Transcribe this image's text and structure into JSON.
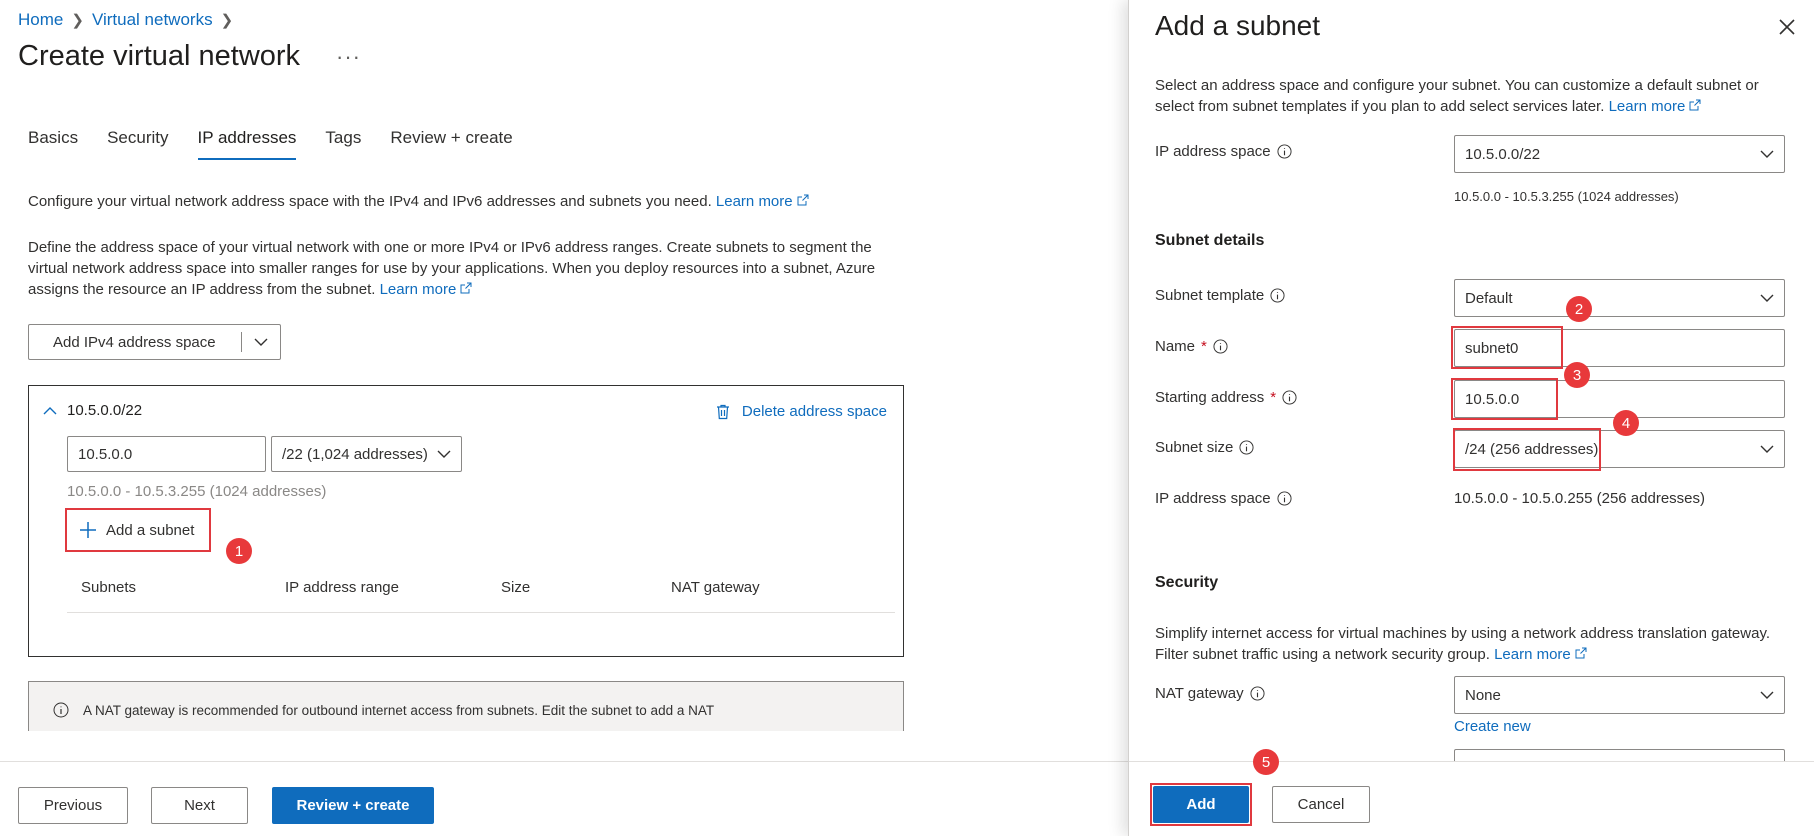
{
  "breadcrumb": {
    "home": "Home",
    "virtual_networks": "Virtual networks"
  },
  "page": {
    "title": "Create virtual network",
    "more": "···"
  },
  "tabs": [
    {
      "label": "Basics"
    },
    {
      "label": "Security"
    },
    {
      "label": "IP addresses",
      "active": true
    },
    {
      "label": "Tags"
    },
    {
      "label": "Review + create"
    }
  ],
  "intro": {
    "line1": "Configure your virtual network address space with the IPv4 and IPv6 addresses and subnets you need.",
    "learn_more": "Learn more",
    "line2": "Define the address space of your virtual network with one or more IPv4 or IPv6 address ranges. Create subnets to segment the virtual network address space into smaller ranges for use by your applications. When you deploy resources into a subnet, Azure assigns the resource an IP address from the subnet."
  },
  "add_space_button": "Add IPv4 address space",
  "address_space": {
    "title": "10.5.0.0/22",
    "delete_label": "Delete address space",
    "address_value": "10.5.0.0",
    "size_value": "/22 (1,024 addresses)",
    "range_text": "10.5.0.0 - 10.5.3.255 (1024 addresses)",
    "add_subnet_label": "Add a subnet",
    "table_headers": [
      "Subnets",
      "IP address range",
      "Size",
      "NAT gateway"
    ]
  },
  "nat_info": "A NAT gateway is recommended for outbound internet access from subnets. Edit the subnet to add a NAT",
  "footer": {
    "previous": "Previous",
    "next": "Next",
    "review": "Review + create"
  },
  "panel": {
    "title": "Add a subnet",
    "description": "Select an address space and configure your subnet. You can customize a default subnet or select from subnet templates if you plan to add select services later.",
    "learn_more": "Learn more",
    "ip_space_label": "IP address space",
    "ip_space_value": "10.5.0.0/22",
    "ip_space_range": "10.5.0.0 - 10.5.3.255 (1024 addresses)",
    "subnet_details_heading": "Subnet details",
    "template_label": "Subnet template",
    "template_value": "Default",
    "name_label": "Name",
    "name_value": "subnet0",
    "starting_label": "Starting address",
    "starting_value": "10.5.0.0",
    "size_label": "Subnet size",
    "size_value": "/24 (256 addresses)",
    "ip_space2_label": "IP address space",
    "ip_space2_value": "10.5.0.0 - 10.5.0.255 (256 addresses)",
    "security_heading": "Security",
    "security_desc": "Simplify internet access for virtual machines by using a network address translation gateway. Filter subnet traffic using a network security group.",
    "security_learn_more": "Learn more",
    "nat_label": "NAT gateway",
    "nat_value": "None",
    "create_new": "Create new",
    "add_button": "Add",
    "cancel_button": "Cancel",
    "required_mark": "*"
  },
  "markers": [
    "1",
    "2",
    "3",
    "4",
    "5"
  ],
  "colors": {
    "accent": "#0f6cbd",
    "highlight": "#e0393f",
    "marker": "#e8393b"
  }
}
